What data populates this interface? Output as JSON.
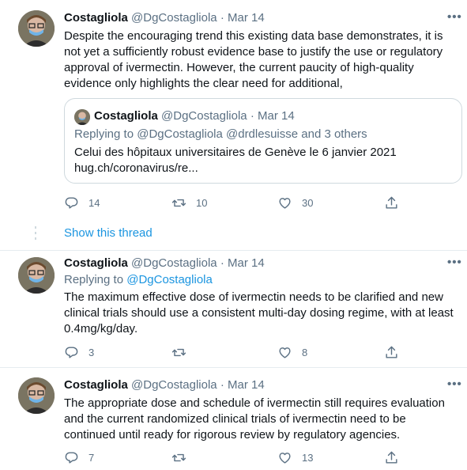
{
  "tweets": [
    {
      "name": "Costagliola",
      "handle": "@DgCostagliola",
      "sep": "·",
      "date": "Mar 14",
      "more": "•••",
      "text": "Despite the encouraging trend this existing data base demonstrates, it is not yet a sufficiently robust evidence base to justify the use or regulatory approval of ivermectin. However, the current paucity of high-quality evidence only highlights the clear need for additional,",
      "quote": {
        "name": "Costagliola",
        "handle": "@DgCostagliola",
        "sep": "·",
        "date": "Mar 14",
        "replying_prefix": "Replying to ",
        "replying_to": "@DgCostagliola @drdlesuisse and 3 others",
        "line1": "Celui des hôpitaux universitaires de Genève le 6 janvier 2021",
        "line2": "hug.ch/coronavirus/re..."
      },
      "actions": {
        "reply": "14",
        "retweet": "10",
        "like": "30"
      }
    },
    {
      "name": "Costagliola",
      "handle": "@DgCostagliola",
      "sep": "·",
      "date": "Mar 14",
      "more": "•••",
      "replying_prefix": "Replying to ",
      "replying_to": "@DgCostagliola",
      "text": "The maximum effective dose of ivermectin needs to be clarified and new clinical trials should use a consistent multi-day dosing regime, with at least 0.4mg/kg/day.",
      "actions": {
        "reply": "3",
        "retweet": "",
        "like": "8"
      }
    },
    {
      "name": "Costagliola",
      "handle": "@DgCostagliola",
      "sep": "·",
      "date": "Mar 14",
      "more": "•••",
      "text": "The appropriate dose and schedule of ivermectin still requires evaluation and the current randomized clinical trials of ivermectin need to be continued until ready for rigorous review by regulatory agencies.",
      "actions": {
        "reply": "7",
        "retweet": "",
        "like": "13"
      }
    }
  ],
  "show_thread": "Show this thread",
  "colors": {
    "accent": "#1b95e0",
    "muted": "#5b7083",
    "text": "#0f1419",
    "border": "#cfd9de"
  },
  "icons": [
    "reply-icon",
    "retweet-icon",
    "like-icon",
    "share-icon",
    "more-icon"
  ]
}
